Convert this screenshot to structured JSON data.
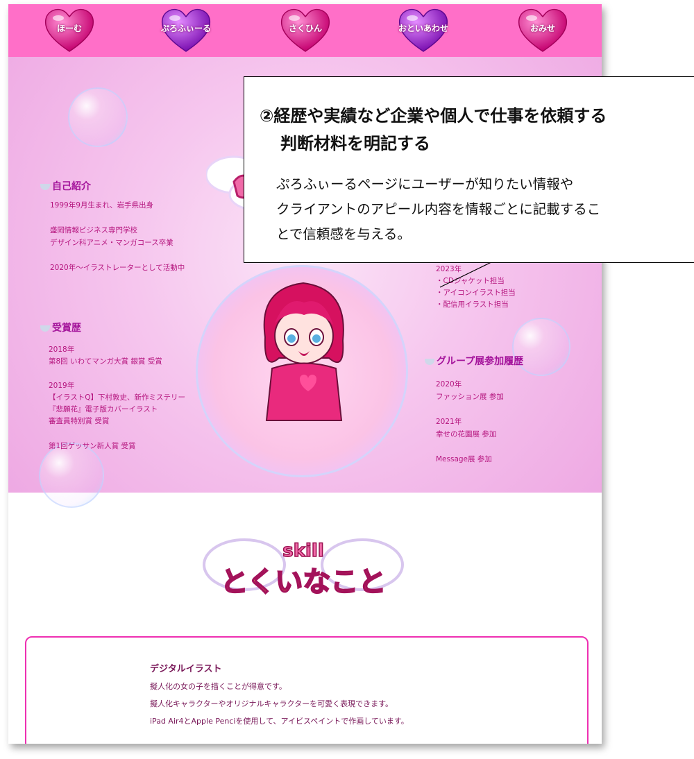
{
  "nav": {
    "items": [
      {
        "label": "ほーむ",
        "color": "#e0138a"
      },
      {
        "label": "ぷろふぃーる",
        "color": "#9b1fd0"
      },
      {
        "label": "さくひん",
        "color": "#e0138a"
      },
      {
        "label": "おといあわせ",
        "color": "#9b1fd0"
      },
      {
        "label": "おみせ",
        "color": "#e0138a"
      }
    ]
  },
  "profile": {
    "intro": {
      "title": "自己紹介",
      "lines": [
        "1999年9月生まれ、岩手県出身",
        "盛岡情報ビジネス専門学校",
        "デザイン科アニメ・マンガコース卒業",
        "2020年〜イラストレーターとして活動中"
      ]
    },
    "awards": {
      "title": "受賞歴",
      "lines": [
        "2018年",
        "第8回 いわてマンガ大賞 銀賞 受賞",
        "2019年",
        "【イラストQ】下村敦史、新作ミステリー",
        "『悲願花』電子版カバーイラスト",
        "審査員特別賞 受賞",
        "第1回ゲッサン新人賞 受賞"
      ]
    },
    "work": {
      "lines": [
        "2023年",
        "・CDジャケット担当",
        "・アイコンイラスト担当",
        "・配信用イラスト担当"
      ]
    },
    "group": {
      "title": "グループ展参加履歴",
      "lines": [
        "2020年",
        "ファッション展 参加",
        "2021年",
        "幸せの花園展 参加",
        "Message展 参加"
      ]
    }
  },
  "skill": {
    "logo_top": "skill",
    "logo_main": "とくいなこと",
    "card": {
      "title": "デジタルイラスト",
      "lines": [
        "擬人化の女の子を描くことが得意です。",
        "擬人化キャラクターやオリジナルキャラクターを可愛く表現できます。",
        "iPad Air4とApple Penciを使用して、アイビスペイントで作画しています。"
      ]
    }
  },
  "callout": {
    "heading_1": "②経歴や実績など企業や個人で仕事を依頼する",
    "heading_2": "判断材料を明記する",
    "body_1": "ぷろふぃーるページにユーザーが知りたい情報や",
    "body_2": "クライアントのアピール内容を情報ごとに記載するこ",
    "body_3": "とで信頼感を与える。"
  }
}
